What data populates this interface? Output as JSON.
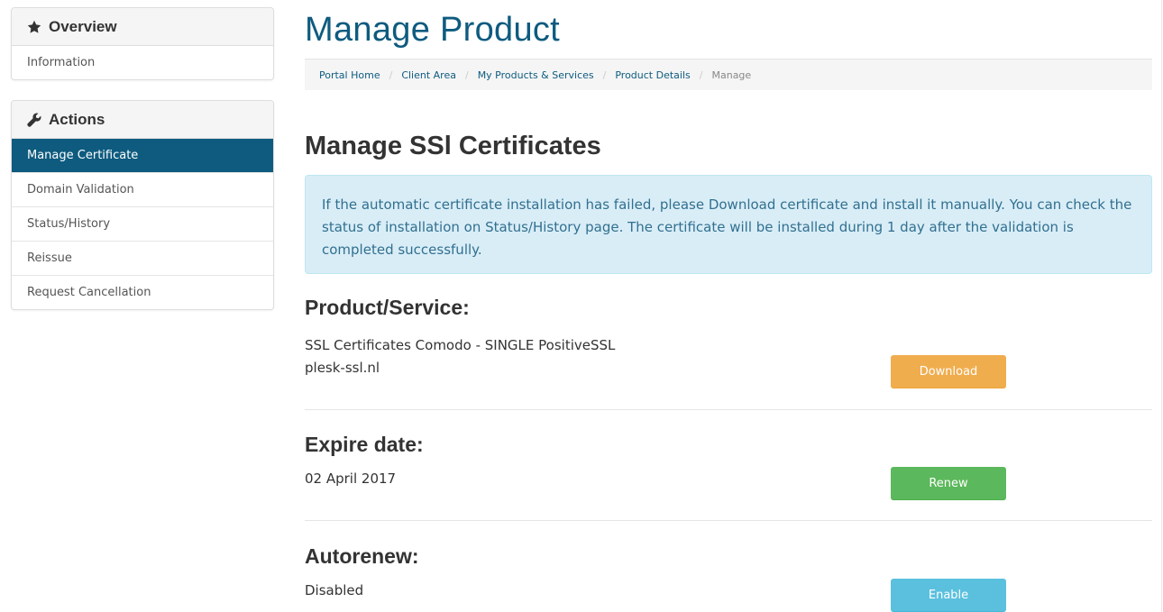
{
  "sidebar": {
    "overview": {
      "title": "Overview",
      "icon": "star-icon",
      "items": [
        {
          "label": "Information"
        }
      ]
    },
    "actions": {
      "title": "Actions",
      "icon": "wrench-icon",
      "items": [
        {
          "label": "Manage Certificate",
          "active": true
        },
        {
          "label": "Domain Validation"
        },
        {
          "label": "Status/History"
        },
        {
          "label": "Reissue"
        },
        {
          "label": "Request Cancellation"
        }
      ]
    }
  },
  "main": {
    "title": "Manage Product",
    "breadcrumb": [
      "Portal Home",
      "Client Area",
      "My Products & Services",
      "Product Details",
      "Manage"
    ],
    "section_title": "Manage SSl Certificates",
    "alert": "If the automatic certificate installation has failed, please Download certificate and install it manually. You can check the status of installation on Status/History page. The certificate will be installed during 1 day after the validation is completed successfully.",
    "product": {
      "title": "Product/Service:",
      "line1": "SSL Certificates Comodo - SINGLE PositiveSSL",
      "line2": "plesk-ssl.nl",
      "button": "Download"
    },
    "expire": {
      "title": "Expire date:",
      "value": "02 April 2017",
      "button": "Renew"
    },
    "autorenew": {
      "title": "Autorenew:",
      "value": "Disabled",
      "button": "Enable"
    }
  },
  "colors": {
    "brand": "#0e5b7f",
    "warning": "#f0ad4e",
    "success": "#5cb85c",
    "info": "#5bc0de",
    "alert_bg": "#d9edf7"
  }
}
